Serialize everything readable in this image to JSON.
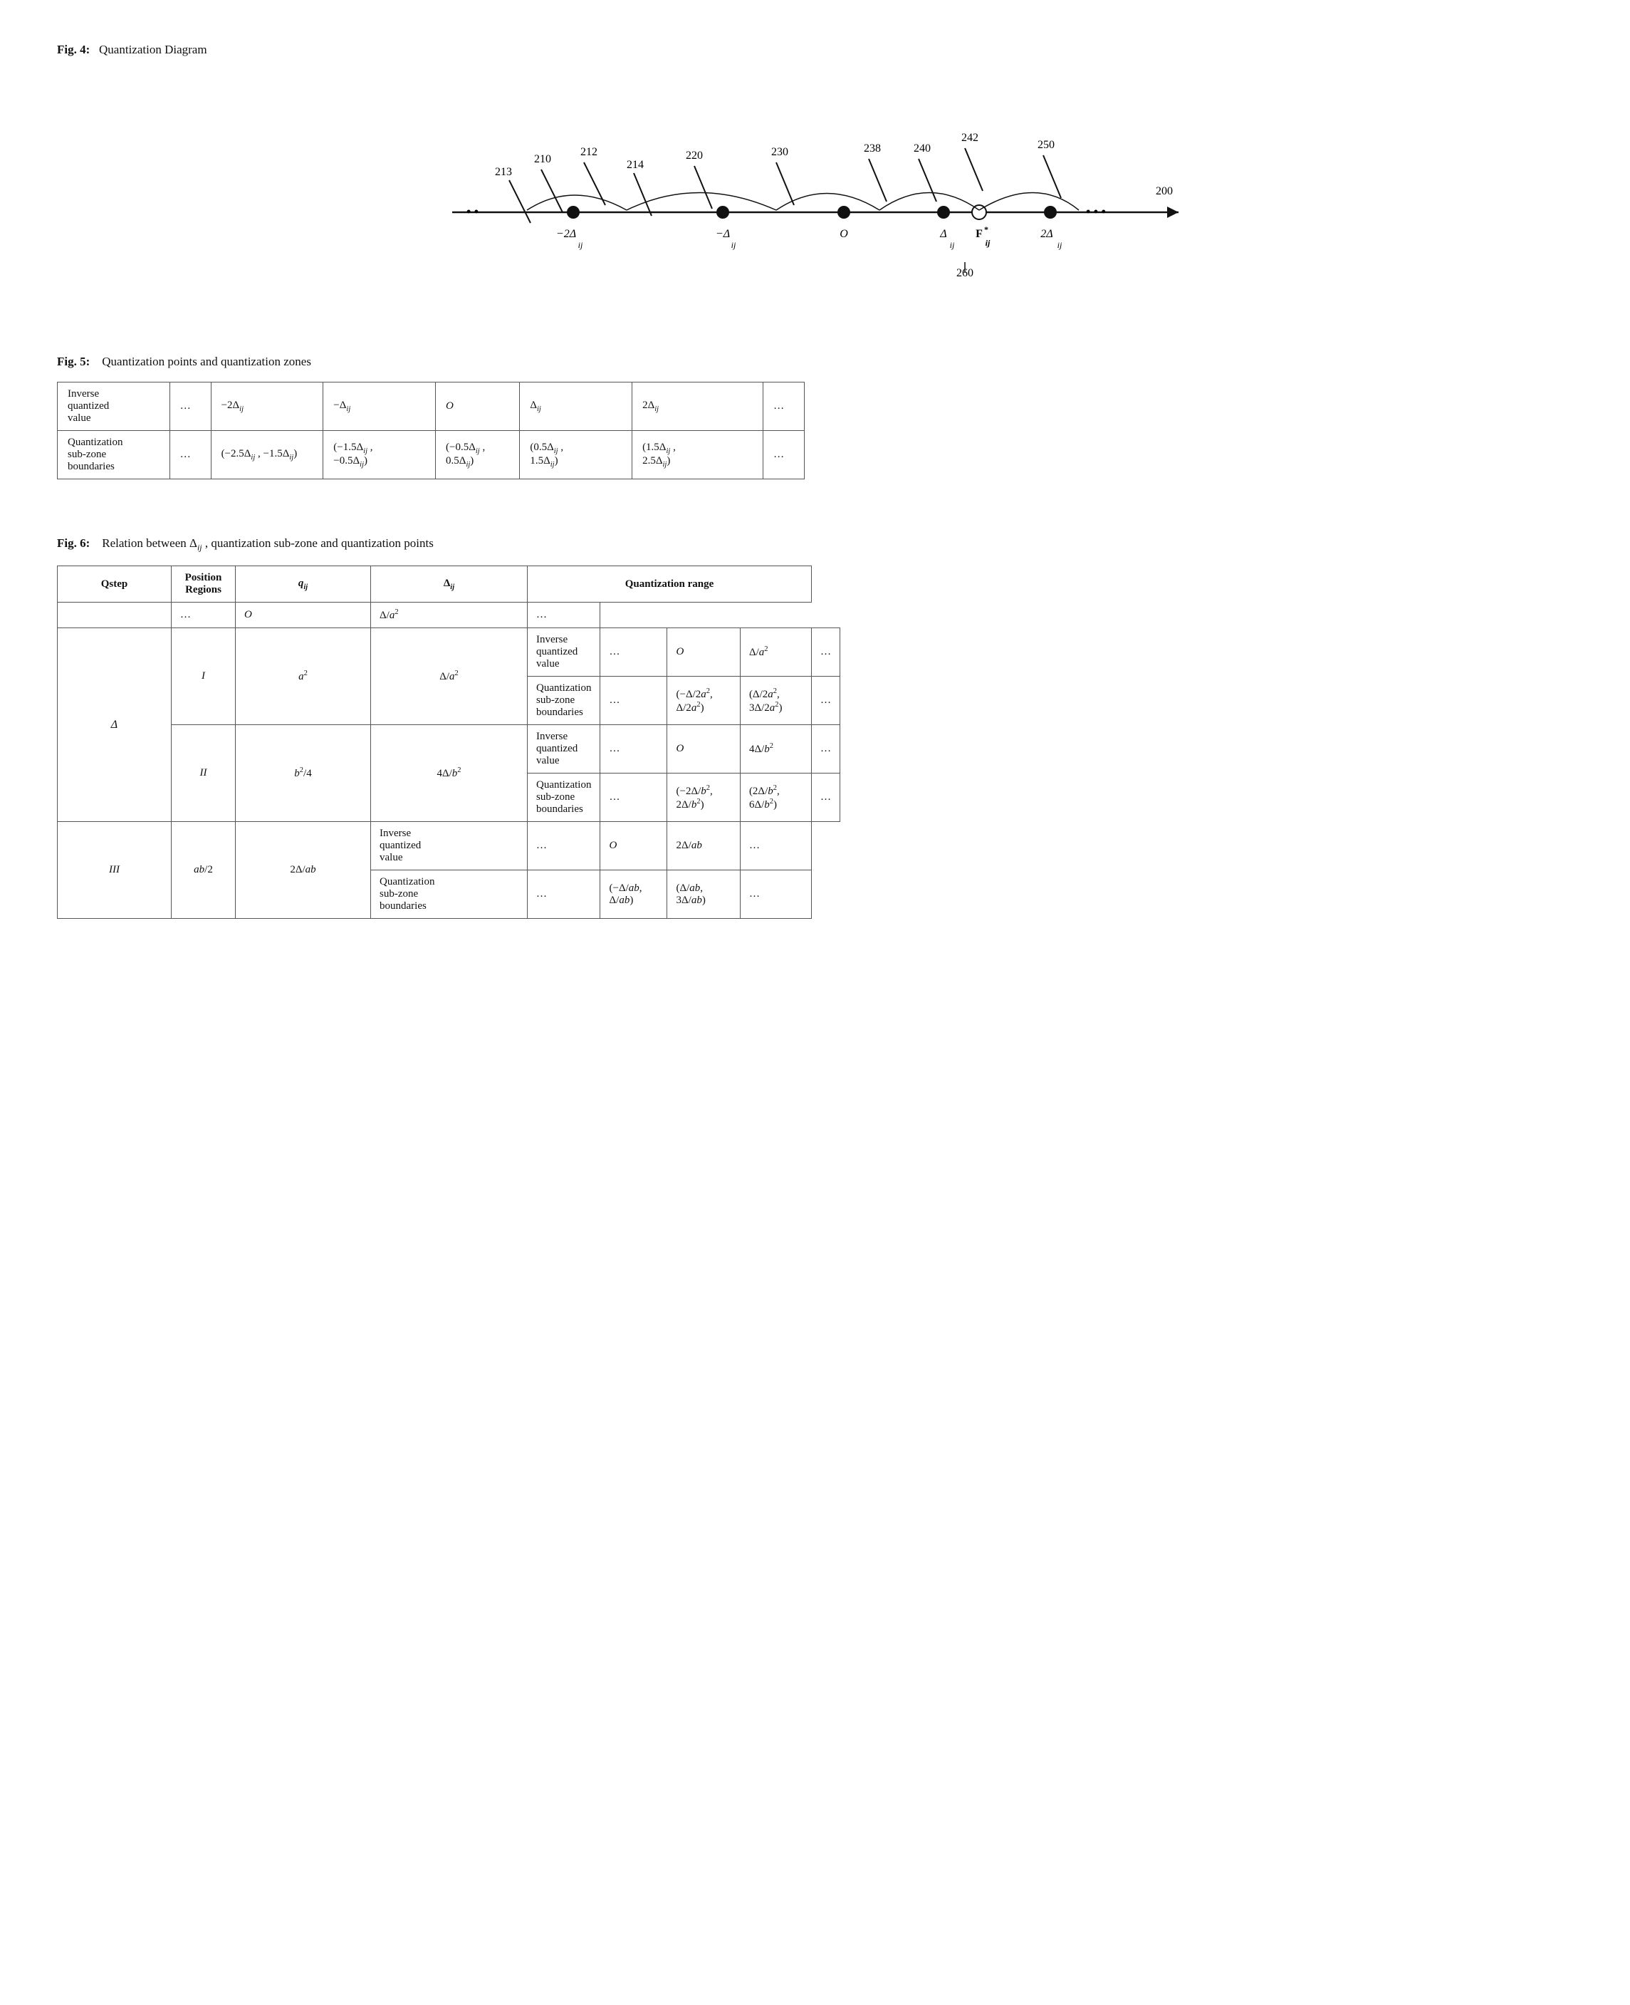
{
  "fig4": {
    "title": "Fig. 4:",
    "title_desc": "Quantization Diagram",
    "labels_above": [
      "213",
      "210",
      "212",
      "214",
      "220",
      "230",
      "238",
      "240",
      "242",
      "250",
      "200"
    ],
    "labels_below": [
      "-2Δij",
      "-Δij",
      "O",
      "Δij",
      "2Δij"
    ],
    "label_260": "260"
  },
  "fig5": {
    "title": "Fig. 5:",
    "title_desc": "Quantization points and quantization zones",
    "headers": [
      "Inverse quantized value",
      "...",
      "−2Δij",
      "−Δij",
      "O",
      "Δij",
      "2Δij",
      "..."
    ],
    "row2_label": "Quantization sub-zone boundaries",
    "row2_dots1": "...",
    "row2_c1": "(−2.5Δij , −1.5Δij)",
    "row2_c2": "(−1.5Δij , −0.5Δij)",
    "row2_c3": "(−0.5Δij , 0.5Δij)",
    "row2_c4": "(0.5Δij , 1.5Δij)",
    "row2_c5": "(1.5Δij , 2.5Δij)",
    "row2_dots2": "..."
  },
  "fig6": {
    "title": "Fig. 6:",
    "title_desc": "Relation between Δij , quantization sub-zone and quantization points",
    "col_headers": [
      "Qstep",
      "Position Regions",
      "qij",
      "Δij",
      "Quantization range"
    ],
    "rows": [
      {
        "qstep": "Δ",
        "region": "I",
        "q": "a²",
        "delta": "Δ/a²",
        "sub": [
          {
            "type": "Inverse quantized value",
            "dots": "...",
            "c1": "O",
            "c2": "Δ/a²",
            "c3": "..."
          },
          {
            "type": "Quantization sub-zone boundaries",
            "dots": "...",
            "c1": "(−Δ/2a², Δ/2a²)",
            "c2": "(Δ/2a², 3Δ/2a²)",
            "c3": "..."
          }
        ]
      },
      {
        "qstep": "",
        "region": "II",
        "q": "b²/4",
        "delta": "4Δ/b²",
        "sub": [
          {
            "type": "Inverse quantized value",
            "dots": "...",
            "c1": "O",
            "c2": "4Δ/b²",
            "c3": "..."
          },
          {
            "type": "Quantization sub-zone boundaries",
            "dots": "...",
            "c1": "(−2Δ/b², 2Δ/b²)",
            "c2": "(2Δ/b², 6Δ/b²)",
            "c3": "..."
          }
        ]
      },
      {
        "qstep": "",
        "region": "III",
        "q": "ab/2",
        "delta": "2Δ/ab",
        "sub": [
          {
            "type": "Inverse quantized value",
            "dots": "...",
            "c1": "O",
            "c2": "2Δ/ab",
            "c3": "..."
          },
          {
            "type": "Quantization sub-zone boundaries",
            "dots": "...",
            "c1": "(−Δ/ab, Δ/ab)",
            "c2": "(Δ/ab, 3Δ/ab)",
            "c3": "..."
          }
        ]
      }
    ]
  }
}
